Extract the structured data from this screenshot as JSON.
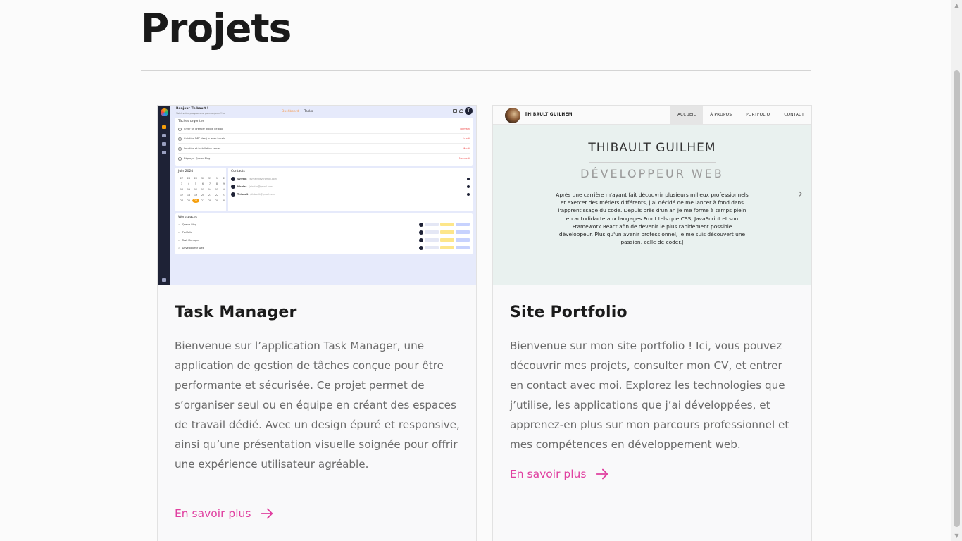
{
  "page": {
    "title": "Projets"
  },
  "projects": [
    {
      "title": "Task Manager",
      "description": "Bienvenue sur l’application Task Manager, une application de gestion de tâches conçue pour être performante et sécurisée. Ce projet permet de s’organiser seul ou en équipe en créant des espaces de travail dédié. Avec un design épuré et responsive, ainsi qu’une présentation visuelle soignée pour offrir une expérience utilisateur agréable.",
      "link_label": "En savoir plus"
    },
    {
      "title": "Site Portfolio",
      "description": "Bienvenue sur mon site portfolio ! Ici, vous pouvez découvrir mes projets, consulter mon CV, et entrer en contact avec moi. Explorez les technologies que j’utilise, les applications que j’ai développées, et apprenez-en plus sur mon parcours professionnel et mes compétences en développement web.",
      "link_label": "En savoir plus"
    }
  ],
  "task_manager_preview": {
    "greeting": "Bonjour Thibault !",
    "subgreeting": "Voici votre programme pour aujourd'hui",
    "nav": [
      "Dashboard",
      "Tasks"
    ],
    "avatar_letter": "T",
    "urgent_title": "Tâches urgentes",
    "urgent_tasks": [
      {
        "label": "Créer un premier article de blog",
        "tag": "Demain"
      },
      {
        "label": "Création DPT Nextj js avec Locald",
        "tag": "Lundi"
      },
      {
        "label": "Location et installation server",
        "tag": "Mardi"
      },
      {
        "label": "Déployer Queue Blog",
        "tag": "Mercredi"
      }
    ],
    "calendar_title": "Juin 2024",
    "calendar_days": [
      "27",
      "28",
      "29",
      "30",
      "31",
      "1",
      "2",
      "3",
      "4",
      "5",
      "6",
      "7",
      "8",
      "9",
      "10",
      "11",
      "12",
      "13",
      "14",
      "15",
      "16",
      "17",
      "18",
      "19",
      "20",
      "21",
      "22",
      "23",
      "24",
      "25",
      "26",
      "27",
      "28",
      "29",
      "30"
    ],
    "calendar_today": "26",
    "contacts_title": "Contacts",
    "contacts": [
      {
        "name": "Sylvain",
        "email": "(sylvaindev@gmail.com)"
      },
      {
        "name": "Nicolas",
        "email": "(nicolas@gmail.com)"
      },
      {
        "name": "Thibault",
        "email": "(thibault@gmail.com)"
      }
    ],
    "workspaces_title": "Workspaces",
    "workspaces": [
      "Queue Blog",
      "Portfolio",
      "Task Manager",
      "Développeur Web"
    ],
    "colors": {
      "sidebar": "#1e2236",
      "accent": "#f59e0b",
      "background": "#e6eafb"
    }
  },
  "portfolio_preview": {
    "brand": "THIBAULT GUILHEM",
    "menu": [
      "ACCUEIL",
      "À PROPOS",
      "PORTFOLIO",
      "CONTACT"
    ],
    "menu_active": "ACCUEIL",
    "hero_title": "THIBAULT GUILHEM",
    "hero_subtitle": "DÉVELOPPEUR WEB",
    "hero_text": "Après une carrière m'ayant fait découvrir plusieurs milieux professionnels et exercer des métiers différents, j'ai décidé de me lancer à fond dans l'apprentissage du code. Depuis près d'un an je me forme à temps plein en autodidacte aux langages Front tels que CSS, JavaScript et son Framework React afin de devenir le plus rapidement possible développeur. Plus qu'un avenir professionnel, je me suis découvert une passion, celle de coder.|",
    "next_arrow": "›"
  },
  "colors": {
    "accent_link": "#e040a0",
    "text_muted": "#6b6b6b",
    "title": "#1a1a1a"
  }
}
